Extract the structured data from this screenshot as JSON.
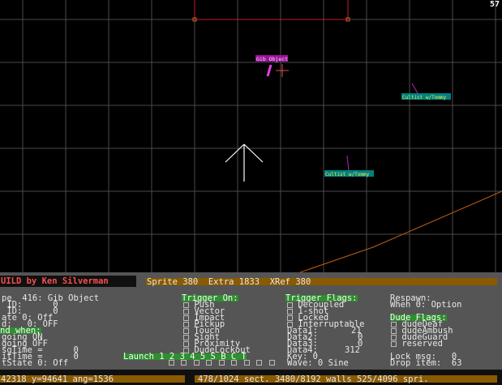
{
  "corner_number": "57",
  "map": {
    "sprites": [
      {
        "label": "Gib Object",
        "kind": "gib"
      },
      {
        "label": "Cultist w/Tommy",
        "kind": "cultist"
      },
      {
        "label": "Cultist w/Tommy",
        "kind": "cultist"
      }
    ]
  },
  "title_bar": {
    "app_title": "UILD by Ken Silverman",
    "sprite_info": "Sprite 380  Extra 1833  XRef 380"
  },
  "left_col": {
    "lines": [
      "pe  416: Gib Object",
      " ID:      0",
      " ID:      0",
      "ate 0: Off",
      "d:   0: OFF"
    ],
    "end_when": "nd when:",
    "lines2": [
      "going ON",
      "going OFF",
      "sgTime =      0",
      "itTime =      0",
      "tState 0: Off"
    ]
  },
  "trigger_on": {
    "header": "Trigger On:",
    "items": [
      "Push",
      "Vector",
      "Impact",
      "Pickup",
      "Touch",
      "Sight",
      "Proximity",
      "DudeLockout"
    ]
  },
  "launch": {
    "label": "Launch",
    "options": [
      "1",
      "2",
      "3",
      "4",
      "5",
      "S",
      "B",
      "C",
      "T"
    ]
  },
  "trigger_flags": {
    "header": "Trigger Flags:",
    "items": [
      "Decoupled",
      "1-shot",
      "Locked",
      "Interruptable"
    ]
  },
  "data_fields": [
    {
      "label": "Data1:",
      "value": "21"
    },
    {
      "label": "Data2:",
      "value": "0"
    },
    {
      "label": "Data3:",
      "value": "0"
    },
    {
      "label": "Data4:",
      "value": "312"
    }
  ],
  "key_line": "Key: 0",
  "wave_line": "Wave: 0 Sine",
  "respawn": {
    "header": "Respawn:",
    "value": "When 0: Option"
  },
  "dude_flags": {
    "header": "Dude Flags:",
    "items": [
      "dudeDeaf",
      "dudeAmbush",
      "dudeGuard",
      "reserved"
    ]
  },
  "lock_msg": "Lock msg:   0",
  "drop_item": "Drop item:  63",
  "status_left": "42318 y=94641 ang=1536",
  "status_right": "478/1024 sect. 3480/8192 walls 525/4096 spri."
}
